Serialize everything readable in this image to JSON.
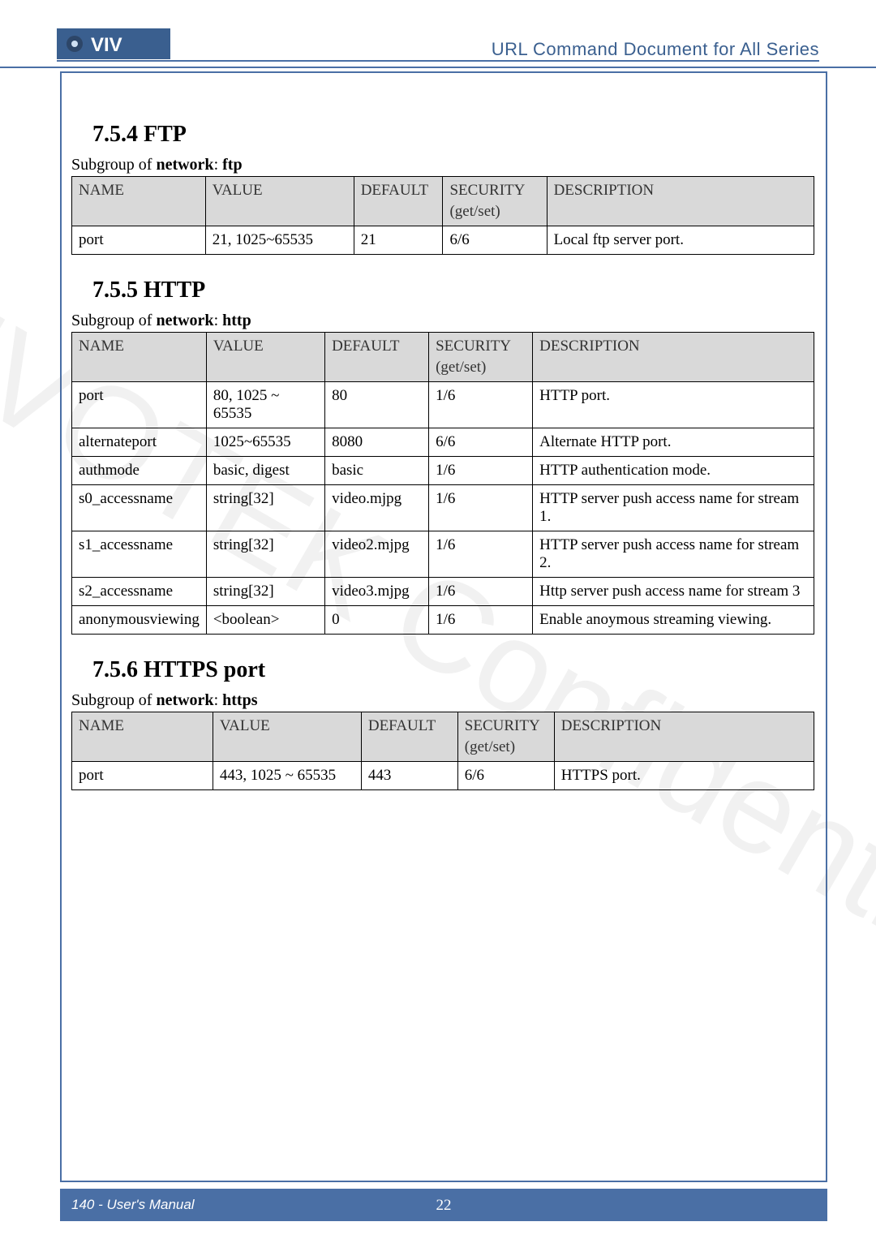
{
  "header": {
    "title": "URL Command Document for All Series"
  },
  "watermark": "VIVOTEK Confidential",
  "sections": {
    "ftp": {
      "heading": "7.5.4 FTP",
      "subgroup_prefix": "Subgroup of ",
      "subgroup_group": "network",
      "subgroup_sep": ": ",
      "subgroup_sub": "ftp",
      "headers": {
        "name": "NAME",
        "value": "VALUE",
        "default": "DEFAULT",
        "security": "SECURITY",
        "security_sub": "(get/set)",
        "description": "DESCRIPTION"
      },
      "rows": [
        {
          "name": "port",
          "value": "21, 1025~65535",
          "default": "21",
          "security": "6/6",
          "description": "Local ftp server port."
        }
      ]
    },
    "http": {
      "heading": "7.5.5 HTTP",
      "subgroup_prefix": "Subgroup of ",
      "subgroup_group": "network",
      "subgroup_sep": ": ",
      "subgroup_sub": "http",
      "headers": {
        "name": "NAME",
        "value": "VALUE",
        "default": "DEFAULT",
        "security": "SECURITY",
        "security_sub": "(get/set)",
        "description": "DESCRIPTION"
      },
      "rows": [
        {
          "name": "port",
          "value": "80, 1025 ~ 65535",
          "default": "80",
          "security": "1/6",
          "description": "HTTP port."
        },
        {
          "name": "alternateport",
          "value": "1025~65535",
          "default": "8080",
          "security": "6/6",
          "description": "Alternate HTTP port."
        },
        {
          "name": "authmode",
          "value": "basic, digest",
          "default": "basic",
          "security": "1/6",
          "description": "HTTP authentication mode."
        },
        {
          "name": "s0_accessname",
          "value": "string[32]",
          "default": "video.mjpg",
          "security": "1/6",
          "description": "HTTP server push access name for stream 1."
        },
        {
          "name": "s1_accessname",
          "value": "string[32]",
          "default": "video2.mjpg",
          "security": "1/6",
          "description": "HTTP server push access name for stream 2."
        },
        {
          "name": "s2_accessname",
          "value": "string[32]",
          "default": "video3.mjpg",
          "security": "1/6",
          "description": "Http server push access name for stream 3"
        },
        {
          "name": "anonymousviewing",
          "value": "<boolean>",
          "default": "0",
          "security": "1/6",
          "description": "Enable anoymous streaming viewing."
        }
      ]
    },
    "https": {
      "heading": "7.5.6 HTTPS port",
      "subgroup_prefix": "Subgroup of ",
      "subgroup_group": "network",
      "subgroup_sep": ": ",
      "subgroup_sub": "https",
      "headers": {
        "name": "NAME",
        "value": "VALUE",
        "default": "DEFAULT",
        "security": "SECURITY",
        "security_sub": "(get/set)",
        "description": "DESCRIPTION"
      },
      "rows": [
        {
          "name": "port",
          "value": "443, 1025 ~ 65535",
          "default": "443",
          "security": "6/6",
          "description": "HTTPS port."
        }
      ]
    }
  },
  "footer": {
    "left": "140 - User's Manual",
    "center": "22"
  }
}
